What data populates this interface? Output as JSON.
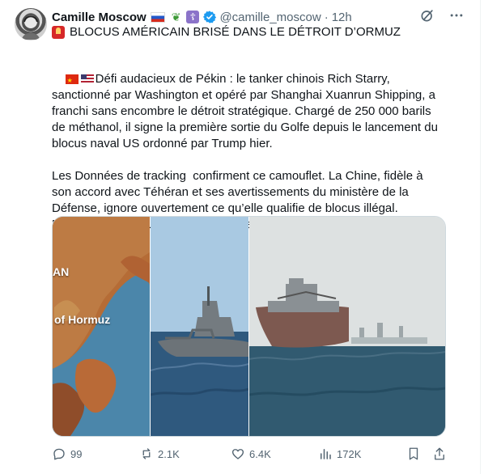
{
  "author": {
    "name": "Camille Moscow",
    "handle": "@camille_moscow",
    "time": "12h",
    "badges": [
      "russia-flag-icon",
      "leaf-icon",
      "orthodox-cross-icon",
      "verified-icon"
    ]
  },
  "subtitle": {
    "text": "BLOCUS AMÉRICAIN BRISÉ DANS LE DÉTROIT D’ORMUZ"
  },
  "post": {
    "paragraph1": "Défi audacieux de Pékin : le tanker chinois Rich Starry, sanctionné par Washington et opéré par Shanghai Xuanrun Shipping, a franchi sans encombre le détroit stratégique. Chargé de 250 000 barils de méthanol, il signe la première sortie du Golfe depuis le lancement du blocus naval US ordonné par Trump hier.",
    "paragraph2": "Les Données de tracking  confirment ce camouflet. La Chine, fidèle à son accord avec Téhéran et ses avertissements du ministère de la Défense, ignore ouvertement ce qu’elle qualifie de blocus illégal. Message clair : Trump ne dicte pas les règles à Pékin."
  },
  "media": {
    "map_labels": {
      "top": "AN",
      "middle": "of Hormuz"
    }
  },
  "actions": {
    "replies": "99",
    "reposts": "2.1K",
    "likes": "6.4K",
    "views": "172K"
  },
  "colors": {
    "muted": "#536471",
    "text": "#0f1419",
    "verified": "#1d9bf0",
    "border": "#cfd9de"
  }
}
